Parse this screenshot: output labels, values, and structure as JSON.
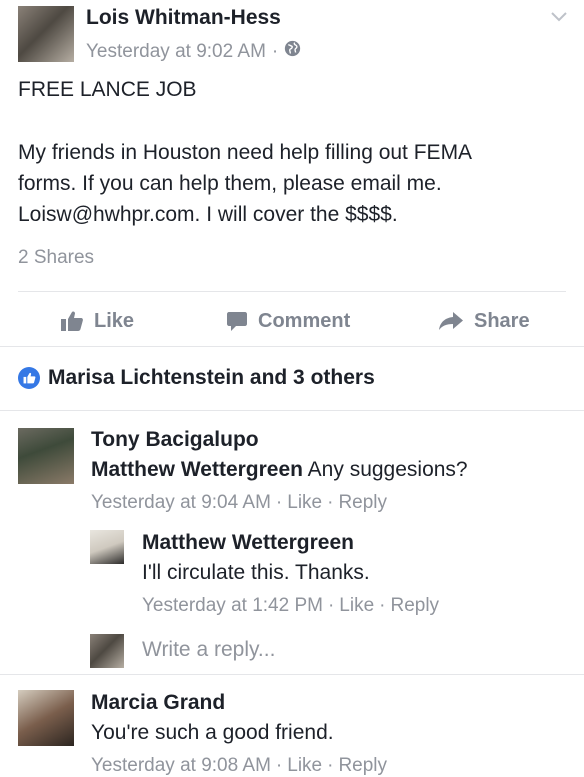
{
  "post": {
    "author": "Lois Whitman-Hess",
    "time": "Yesterday at 9:02 AM",
    "dot": "·",
    "title": "FREE LANCE JOB",
    "lines": [
      "My friends in Houston need help filling  out FEMA",
      "forms. If you can help them, please email me.",
      "Loisw@hwhpr.com. I will cover the $$$$."
    ],
    "shares": "2 Shares"
  },
  "actions": {
    "like": "Like",
    "comment": "Comment",
    "share": "Share"
  },
  "reactions": {
    "text": "Marisa Lichtenstein and 3 others"
  },
  "comments": [
    {
      "author": "Tony Bacigalupo",
      "tag": "Matthew Wettergreen",
      "text": "Any suggesions?",
      "time": "Yesterday at 9:04 AM",
      "like": "Like",
      "reply": "Reply",
      "sep": "·"
    },
    {
      "author": "Marcia Grand",
      "text": "You're such a good friend.",
      "time": "Yesterday at 9:08 AM",
      "like": "Like",
      "reply": "Reply",
      "sep": "·"
    }
  ],
  "reply": {
    "author": "Matthew Wettergreen",
    "text": "I'll circulate this. Thanks.",
    "time": "Yesterday at 1:42 PM",
    "like": "Like",
    "reply": "Reply",
    "sep": "·"
  },
  "write_reply": {
    "placeholder": "Write a reply..."
  },
  "icons": {
    "chevron": "chevron-down-icon",
    "globe": "globe-icon",
    "like": "thumbs-up-icon",
    "comment": "comment-bubble-icon",
    "share": "share-arrow-icon"
  },
  "colors": {
    "accent": "#3578e5",
    "muted": "#90949c",
    "text": "#1d2129"
  }
}
